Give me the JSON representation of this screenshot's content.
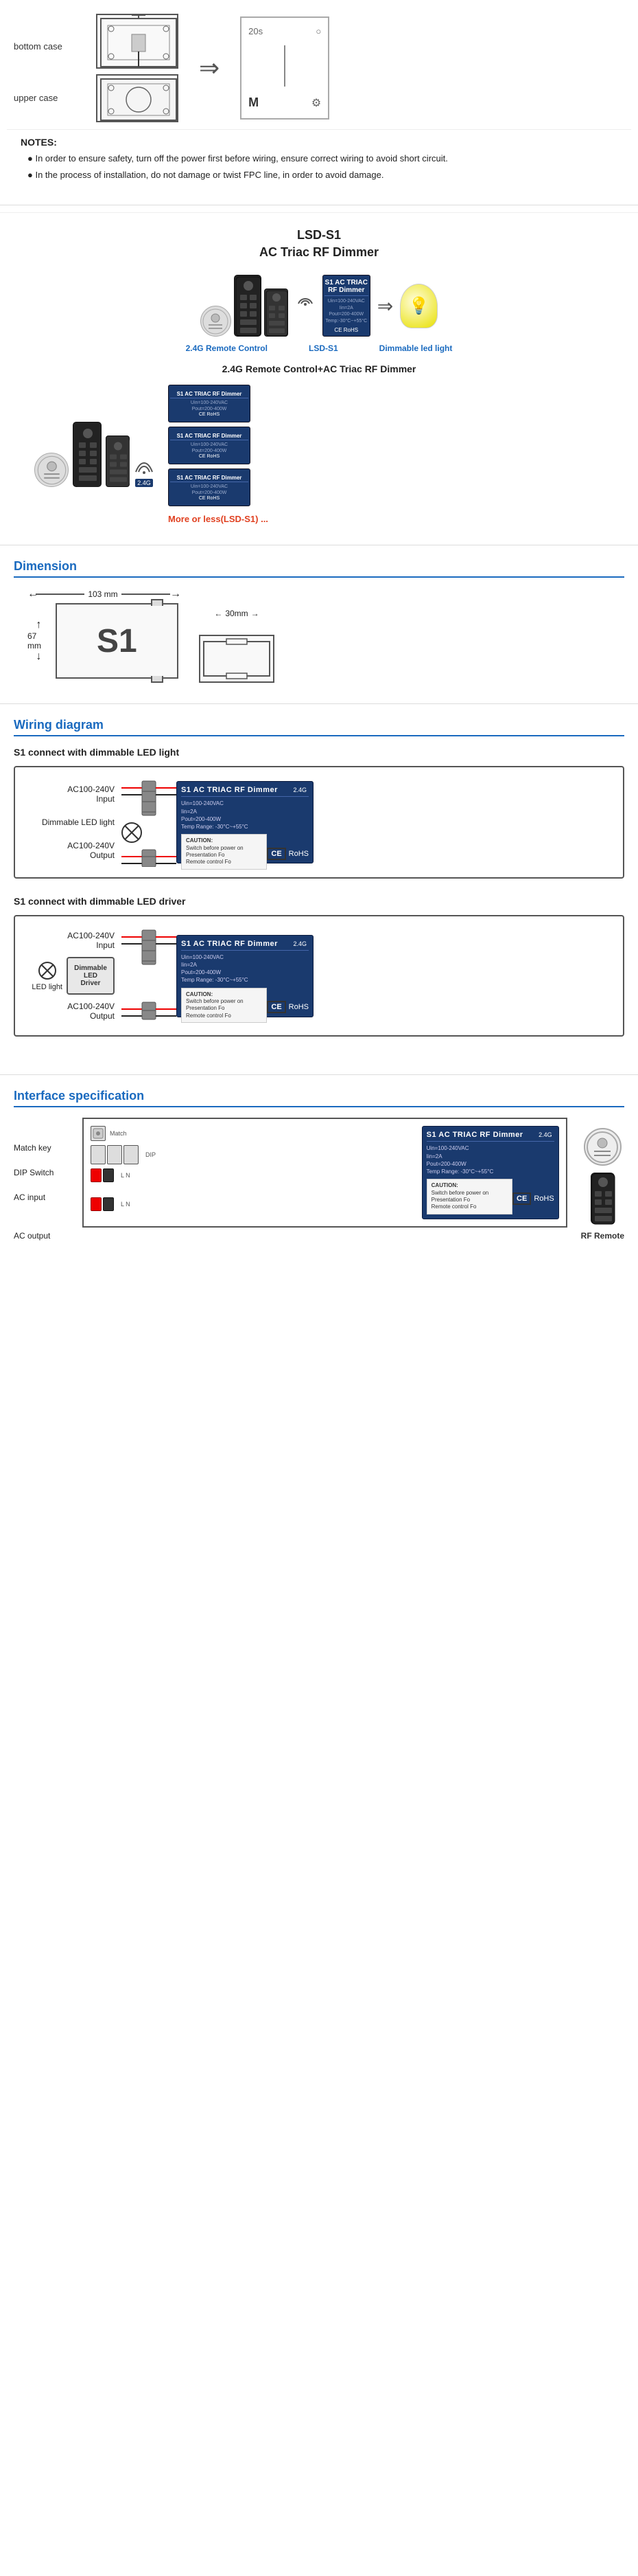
{
  "installation": {
    "label_bottom": "bottom case",
    "label_upper": "upper case",
    "screen_top_time": "20s",
    "screen_m": "M",
    "screen_gear": "⚙"
  },
  "notes": {
    "title": "NOTES:",
    "note1": "● In order to ensure safety, turn off the power first before wiring, ensure correct wiring to avoid short circuit.",
    "note2": "● In the process of installation, do not damage or twist FPC line, in order to avoid damage."
  },
  "product": {
    "title_line1": "LSD-S1",
    "title_line2": "AC Triac RF Dimmer",
    "label_remote": "2.4G Remote Control",
    "label_device": "LSD-S1",
    "label_bulb": "Dimmable led light",
    "combo_title": "2.4G  Remote Control+AC Triac RF Dimmer",
    "more_text": "More or less(LSD-S1) ...",
    "badge_24g": "2.4G"
  },
  "dimension": {
    "title": "Dimension",
    "width_mm": "103 mm",
    "height_mm": "67 mm",
    "label_s1": "S1",
    "secondary_mm": "30mm"
  },
  "wiring": {
    "title": "Wiring diagram",
    "sub1": "S1 connect with dimmable LED light",
    "sub2": "S1 connect with dimmable LED driver",
    "label_dimmable_led": "Dimmable LED light",
    "label_input": "AC100-240V\nInput",
    "label_output": "AC100-240V\nOutput",
    "label_led_light": "LED light",
    "label_driver": "Dimmable LED\nDriver",
    "device_title": "S1  AC TRIAC RF Dimmer",
    "device_badge": "2.4G",
    "device_spec1": "Uin=100-240VAC",
    "device_spec2": "Iin=2A",
    "device_spec3": "Pout=200-400W",
    "device_spec4": "Temp Range: -30°C~+55°C",
    "caution_title": "CAUTION:",
    "caution1": "Switch before power on",
    "caution2": "Presentation Fo",
    "caution3": "Remote control Fo",
    "rohs": "RoHS"
  },
  "interface": {
    "title": "Interface specification",
    "label_match": "Match key",
    "label_dip": "DIP Switch",
    "label_ac_input": "AC input",
    "label_ac_output": "AC output",
    "label_rf_remote": "RF Remote",
    "device_title": "S1  AC TRIAC RF Dimmer",
    "device_badge": "2.4G"
  }
}
